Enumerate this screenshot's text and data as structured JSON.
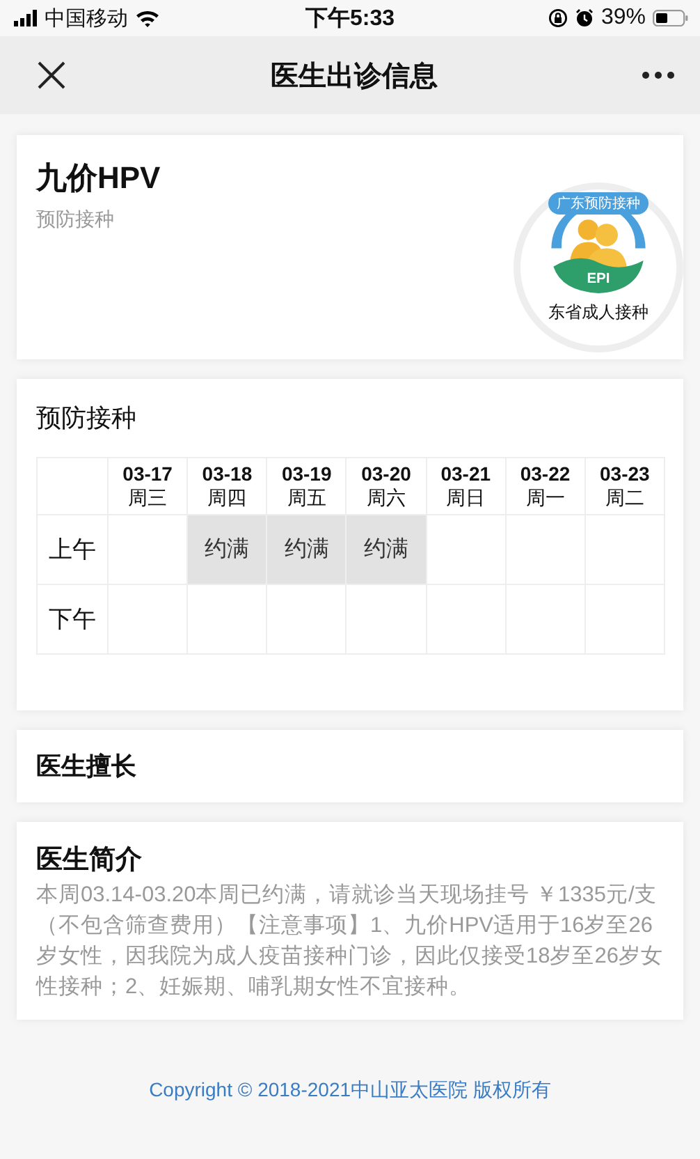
{
  "status_bar": {
    "carrier": "中国移动",
    "time": "下午5:33",
    "battery": "39%"
  },
  "nav": {
    "title": "医生出诊信息"
  },
  "doctor": {
    "name": "九价HPV",
    "department": "预防接种",
    "logo": {
      "arc_text": "广东预防接种",
      "badge": "EPI",
      "caption": "东省成人接种"
    }
  },
  "schedule": {
    "title": "预防接种",
    "days": [
      {
        "date": "03-17",
        "weekday": "周三"
      },
      {
        "date": "03-18",
        "weekday": "周四"
      },
      {
        "date": "03-19",
        "weekday": "周五"
      },
      {
        "date": "03-20",
        "weekday": "周六"
      },
      {
        "date": "03-21",
        "weekday": "周日"
      },
      {
        "date": "03-22",
        "weekday": "周一"
      },
      {
        "date": "03-23",
        "weekday": "周二"
      }
    ],
    "rows": [
      {
        "period": "上午",
        "cells": [
          {
            "full": false
          },
          {
            "full": true,
            "text": "约满"
          },
          {
            "full": true,
            "text": "约满"
          },
          {
            "full": true,
            "text": "约满"
          },
          {
            "full": false
          },
          {
            "full": false
          },
          {
            "full": false
          }
        ]
      },
      {
        "period": "下午",
        "cells": [
          {
            "full": false
          },
          {
            "full": false
          },
          {
            "full": false
          },
          {
            "full": false
          },
          {
            "full": false
          },
          {
            "full": false
          },
          {
            "full": false
          }
        ]
      }
    ]
  },
  "specialty": {
    "title": "医生擅长"
  },
  "intro": {
    "title": "医生简介",
    "text": "本周03.14-03.20本周已约满，请就诊当天现场挂号 ￥1335元/支（不包含筛查费用）【注意事项】1、九价HPV适用于16岁至26岁女性，因我院为成人疫苗接种门诊，因此仅接受18岁至26岁女性接种；2、妊娠期、哺乳期女性不宜接种。"
  },
  "footer": {
    "copyright": "Copyright © 2018-2021中山亚太医院 版权所有"
  }
}
